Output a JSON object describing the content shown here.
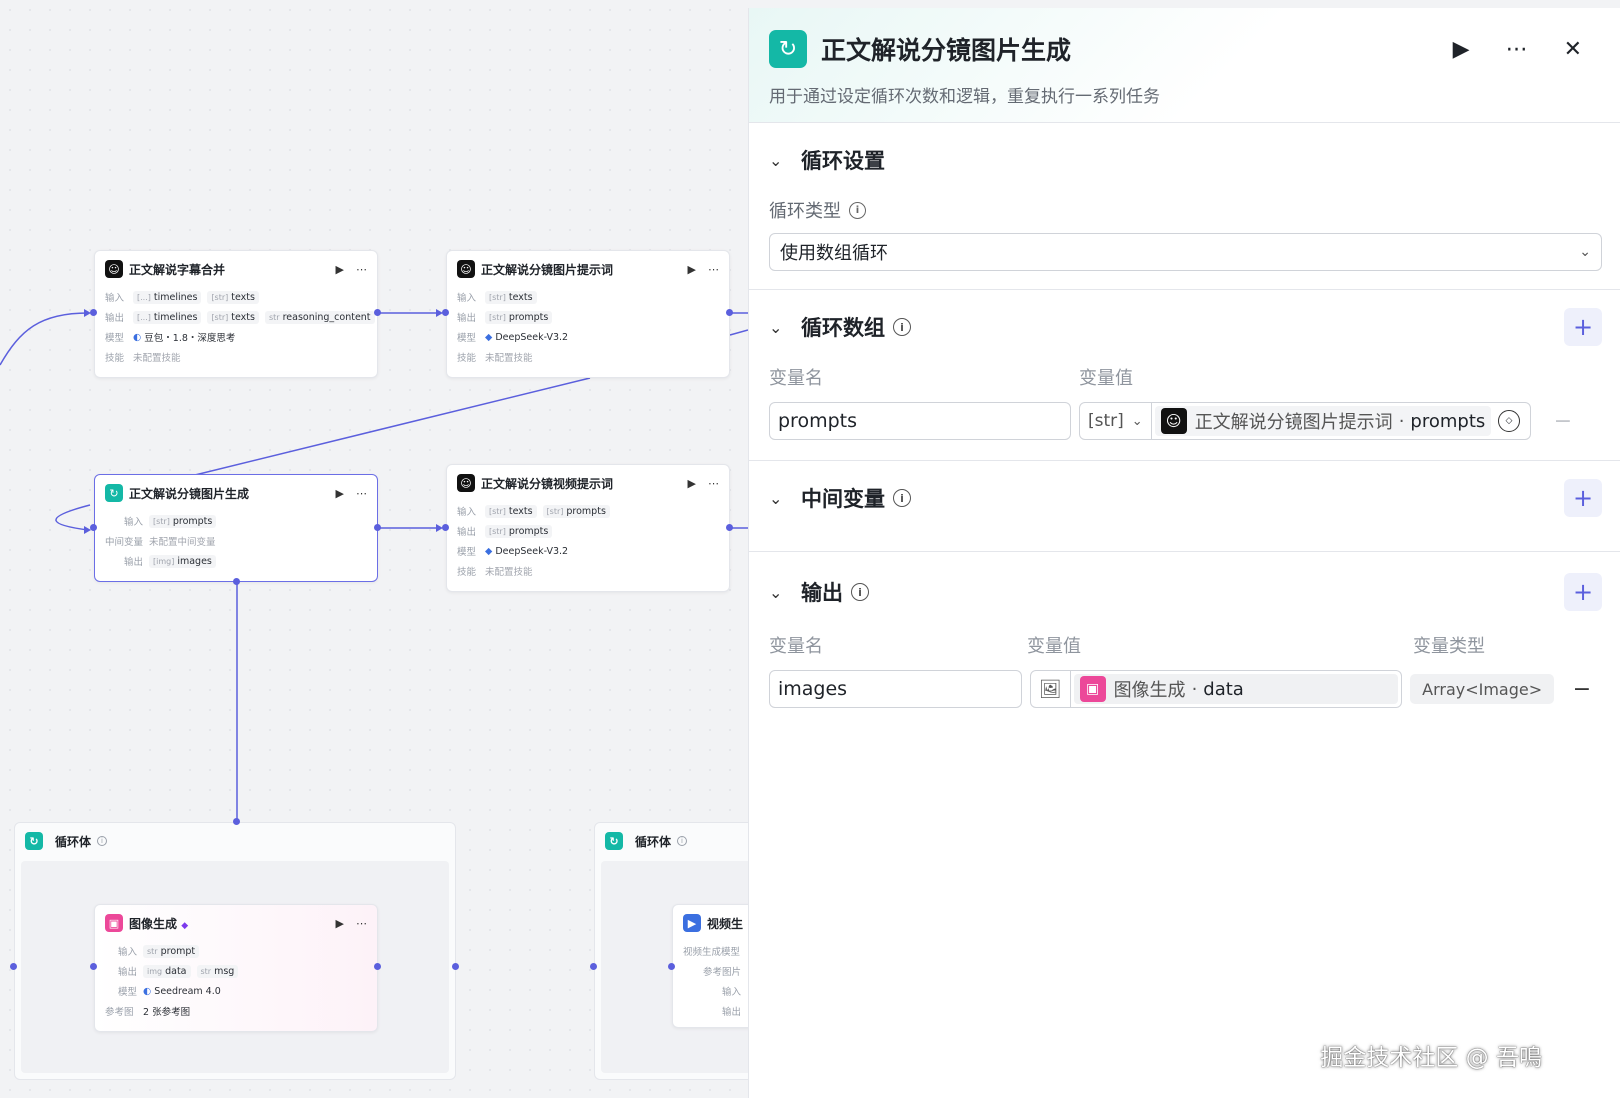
{
  "canvas": {
    "nodes": {
      "subtitle_merge": {
        "title": "正文解说字幕合并",
        "input_label": "输入",
        "output_label": "输出",
        "model_label": "模型",
        "skill_label": "技能",
        "inputs": [
          {
            "type": "[...]",
            "name": "timelines"
          },
          {
            "type": "[str]",
            "name": "texts"
          }
        ],
        "outputs": [
          {
            "type": "[...]",
            "name": "timelines"
          },
          {
            "type": "[str]",
            "name": "texts"
          },
          {
            "type": "str",
            "name": "reasoning_content"
          }
        ],
        "model": "豆包・1.8・深度思考",
        "skill": "未配置技能"
      },
      "image_prompt": {
        "title": "正文解说分镜图片提示词",
        "input_label": "输入",
        "output_label": "输出",
        "model_label": "模型",
        "skill_label": "技能",
        "inputs": [
          {
            "type": "[str]",
            "name": "texts"
          }
        ],
        "outputs": [
          {
            "type": "[str]",
            "name": "prompts"
          }
        ],
        "model": "DeepSeek-V3.2",
        "skill": "未配置技能"
      },
      "image_gen_loop": {
        "title": "正文解说分镜图片生成",
        "input_label": "输入",
        "mid_label": "中间变量",
        "output_label": "输出",
        "inputs": [
          {
            "type": "[str]",
            "name": "prompts"
          }
        ],
        "mid": "未配置中间变量",
        "outputs": [
          {
            "type": "[img]",
            "name": "images"
          }
        ]
      },
      "video_prompt": {
        "title": "正文解说分镜视频提示词",
        "input_label": "输入",
        "output_label": "输出",
        "model_label": "模型",
        "skill_label": "技能",
        "inputs": [
          {
            "type": "[str]",
            "name": "texts"
          },
          {
            "type": "[str]",
            "name": "prompts"
          }
        ],
        "outputs": [
          {
            "type": "[str]",
            "name": "prompts"
          }
        ],
        "model": "DeepSeek-V3.2",
        "skill": "未配置技能"
      },
      "loop_body_1": {
        "title": "循环体"
      },
      "loop_body_2": {
        "title": "循环体"
      },
      "image_gen": {
        "title": "图像生成",
        "input_label": "输入",
        "output_label": "输出",
        "model_label": "模型",
        "ref_label": "参考图",
        "inputs": [
          {
            "type": "str",
            "name": "prompt"
          }
        ],
        "outputs": [
          {
            "type": "img",
            "name": "data"
          },
          {
            "type": "str",
            "name": "msg"
          }
        ],
        "model": "Seedream 4.0",
        "ref": "2 张参考图"
      },
      "video_gen": {
        "title": "视频生",
        "rows": [
          "视频生成模型",
          "参考图片",
          "输入",
          "输出"
        ]
      }
    }
  },
  "panel": {
    "title": "正文解说分镜图片生成",
    "description": "用于通过设定循环次数和逻辑，重复执行一系列任务",
    "loop_settings": {
      "title": "循环设置",
      "loop_type_label": "循环类型",
      "loop_type_value": "使用数组循环"
    },
    "loop_array": {
      "title": "循环数组",
      "col_name": "变量名",
      "col_value": "变量值",
      "rows": [
        {
          "name": "prompts",
          "type": "[str]",
          "ref_node": "正文解说分镜图片提示词",
          "ref_sep": "·",
          "ref_var": "prompts"
        }
      ]
    },
    "intermediate": {
      "title": "中间变量"
    },
    "output": {
      "title": "输出",
      "col_name": "变量名",
      "col_value": "变量值",
      "col_type": "变量类型",
      "rows": [
        {
          "name": "images",
          "ref_node": "图像生成",
          "ref_sep": "·",
          "ref_var": "data",
          "type": "Array<Image>"
        }
      ]
    }
  },
  "watermark": "掘金技术社区 @ 吾鳴",
  "colors": {
    "accent": "#5b5fdd",
    "teal": "#14b8a6",
    "pink": "#ec4899"
  }
}
